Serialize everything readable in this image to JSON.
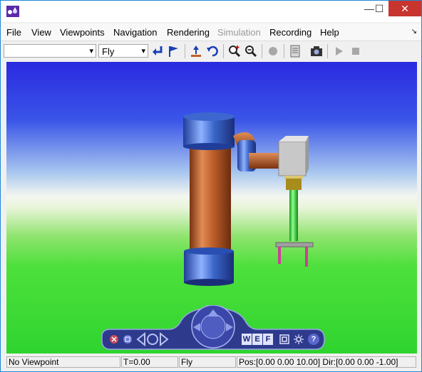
{
  "window": {
    "minimize_glyph": "—",
    "maximize_glyph": "☐",
    "close_glyph": "✕"
  },
  "menu": {
    "items": [
      {
        "label": "File",
        "enabled": true
      },
      {
        "label": "View",
        "enabled": true
      },
      {
        "label": "Viewpoints",
        "enabled": true
      },
      {
        "label": "Navigation",
        "enabled": true
      },
      {
        "label": "Rendering",
        "enabled": true
      },
      {
        "label": "Simulation",
        "enabled": false
      },
      {
        "label": "Recording",
        "enabled": true
      },
      {
        "label": "Help",
        "enabled": true
      }
    ],
    "overflow_glyph": "↘"
  },
  "toolbar": {
    "viewpoint_select_value": "",
    "navigation_mode_value": "Fly",
    "icons": [
      "return-to-viewpoint-icon",
      "flag-icon",
      "straighten-up-icon",
      "undo-move-icon",
      "zoom-in-icon",
      "zoom-out-icon",
      "record-disabled-icon",
      "notes-icon",
      "snapshot-camera-icon",
      "play-disabled-icon",
      "stop-disabled-icon"
    ]
  },
  "status": {
    "viewpoint": "No Viewpoint",
    "time": "T=0.00",
    "mode": "Fly",
    "position": "Pos:[0.00 0.00 10.00] Dir:[0.00 0.00 -1.00]"
  },
  "nav_panel": {
    "buttons": [
      "W",
      "E",
      "F",
      "?"
    ]
  },
  "colors": {
    "titlebar_close": "#c7352e",
    "sky_top": "#2a2ae0",
    "ground": "#2fd42f",
    "cylinder_blue": "#3a66c9",
    "body_copper": "#c0602b",
    "nav_panel": "#2e3a8c"
  }
}
